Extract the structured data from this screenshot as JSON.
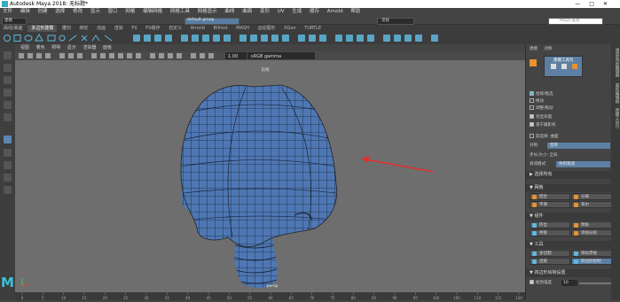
{
  "window": {
    "title": "Autodesk Maya 2018: 无标题*",
    "controls": [
      "—",
      "□",
      "✕"
    ]
  },
  "menubar": {
    "items": [
      "文件",
      "编辑",
      "创建",
      "选择",
      "修改",
      "显示",
      "窗口",
      "网格",
      "编辑网格",
      "网格工具",
      "网格显示",
      "曲线",
      "曲面",
      "变形",
      "UV",
      "生成",
      "缓存",
      "Arnold",
      "帮助"
    ]
  },
  "statusline": {
    "mode": "建模",
    "object_field": "default group",
    "search_placeholder": "Maya 查找",
    "workspace": "常规"
  },
  "shelf": {
    "tabs": [
      "曲线/曲面",
      "多边形建模",
      "雕刻",
      "绑定",
      "动画",
      "渲染",
      "FX",
      "FX缓存",
      "自定义",
      "Arnold",
      "Bifrost",
      "MASH",
      "运动图形",
      "XGen",
      "TURTLE"
    ],
    "active_tab": 1
  },
  "viewport": {
    "menu": [
      "视图",
      "着色",
      "照明",
      "显示",
      "渲染器",
      "面板"
    ],
    "camera_label": "persp",
    "top_label": "前视",
    "colorspace": "sRGB gamma",
    "gamma_value": "1.00",
    "annotation_arrow_color": "#e03030",
    "mesh_color": "#4e77b4"
  },
  "rightpanel": {
    "tabs": [
      "建模",
      "对称"
    ],
    "modeling_toolkit_title": "建模工具包",
    "options": [
      {
        "label": "拾取/框选",
        "checked": true
      },
      {
        "label": "拖动",
        "checked": false
      },
      {
        "label": "调整/拖动",
        "checked": false
      },
      {
        "label": "亮显背面",
        "checked": true
      },
      {
        "label": "基于摄影机",
        "checked": true
      }
    ],
    "soft_select_label": "软选择",
    "soft_select_value": "曲面",
    "symmetry_label": "对称:",
    "symmetry_value": "禁用",
    "step_label": "步长/大小:",
    "step_value": "全局",
    "falloff_label": "衰减模式:",
    "falloff_value": "体积衰减",
    "select_all_label": "选择所有",
    "sections": {
      "mesh": {
        "title": "网格",
        "buttons": [
          "结合",
          "分离",
          "平滑",
          "布尔"
        ]
      },
      "components": {
        "title": "组件",
        "buttons": [
          "挤出",
          "倒角",
          "桥接",
          "添加分段"
        ]
      },
      "tools": {
        "title": "工具",
        "buttons": [
          "多切割",
          "目标焊接",
          "连接",
          "四边形绘制"
        ]
      }
    },
    "bottom_label": "四边形绘制设置",
    "relax_label": "松弛强度",
    "relax_value": "10",
    "side_labels": [
      "通道盒/层编辑器",
      "属性编辑器",
      "建模工具包"
    ]
  },
  "timeline": {
    "ticks": [
      "0",
      "5",
      "10",
      "15",
      "20",
      "25",
      "30",
      "35",
      "40",
      "45",
      "50",
      "55",
      "60",
      "65",
      "70",
      "75",
      "80",
      "85",
      "90",
      "95",
      "100",
      "105",
      "110",
      "115",
      "120"
    ]
  }
}
